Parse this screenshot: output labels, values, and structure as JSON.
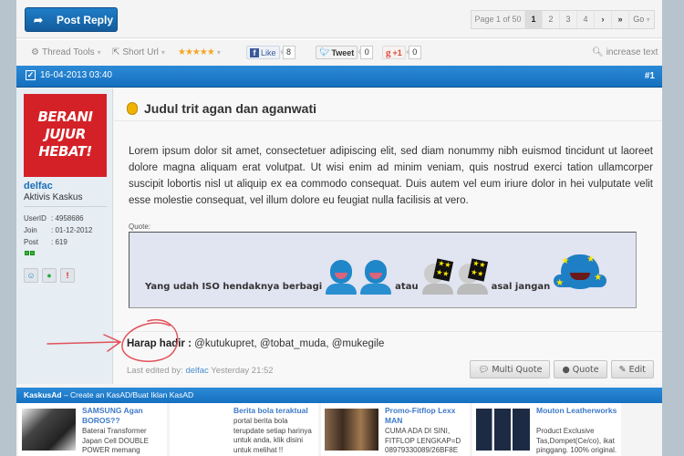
{
  "topbar": {
    "post_reply_label": "Post Reply",
    "pager": {
      "info": "Page 1 of 50",
      "pages": [
        "1",
        "2",
        "3",
        "4"
      ],
      "active_page": "1",
      "next_icon": "›",
      "last_icon": "»",
      "go_label": "Go"
    }
  },
  "tools": {
    "thread_tools": "Thread Tools",
    "short_url": "Short Url",
    "rating_stars": "★★★★★",
    "facebook": {
      "label": "Like",
      "count": "8"
    },
    "twitter": {
      "label": "Tweet",
      "count": "0"
    },
    "gplus": {
      "label": "+1",
      "count": "0"
    },
    "increase_text": "increase text"
  },
  "post": {
    "date": "16-04-2013 03:40",
    "number": "#1",
    "user": {
      "avatar_text": [
        "BERANI",
        "JUJUR",
        "HEBAT!"
      ],
      "name": "delfac",
      "rank": "Aktivis Kaskus",
      "stats": [
        {
          "key": "UserID",
          "value": ": 4958686"
        },
        {
          "key": "Join",
          "value": ": 01-12-2012"
        },
        {
          "key": "Post",
          "value": ": 619"
        }
      ]
    },
    "title": "Judul trit agan dan aganwati",
    "body": "Lorem ipsum dolor sit amet, consectetuer adipiscing elit, sed diam nonummy nibh euismod tincidunt ut laoreet dolore magna aliquam erat volutpat. Ut wisi enim ad minim veniam, quis nostrud exerci tation ullamcorper suscipit lobortis nisl ut aliquip ex ea commodo consequat. Duis autem vel eum iriure dolor in hei vulputate velit esse molestie consequat, vel illum dolore eu feugiat nulla facilisis at vero.",
    "quote": {
      "label": "Quote:",
      "text1": "Yang udah ISO hendaknya berbagi",
      "text2": "atau",
      "text3": "asal jangan"
    },
    "mentions": {
      "label": "Harap hadir :",
      "users": "@kutukupret,  @tobat_muda,  @mukegile"
    },
    "edited": {
      "prefix": "Last edited by:",
      "user": "delfac",
      "when": "Yesterday 21:52"
    },
    "buttons": {
      "multi_quote": "Multi Quote",
      "quote": "Quote",
      "edit": "Edit"
    }
  },
  "kaskusad": {
    "title": "KaskusAd",
    "subtitle": " – Create an KasAD/Buat Iklan KasAD",
    "ads": [
      {
        "title": "SAMSUNG Agan BOROS??",
        "desc": "Baterai Transformer Japan Cell DOUBLE POWER memang"
      },
      {
        "title": "Berita bola teraktual",
        "desc": "portal berita bola terupdate setiap harinya untuk anda, klik disini untuk melihat !!"
      },
      {
        "title": "Promo-Fitflop Lexx MAN",
        "desc": "CUMA ADA DI SINI, FITFLOP LENGKAP=D 08979330089/26BF8E"
      },
      {
        "title": "Mouton Leatherworks",
        "desc": "Product Exclusive Tas,Dompet(Ce/co), ikat pinggang. 100% original."
      }
    ]
  },
  "colors": {
    "accent_blue": "#1570c0",
    "button_blue": "#135c9c",
    "avatar_red": "#d42127",
    "link_blue": "#3d7ac8",
    "annotation_red": "#e0525a"
  }
}
